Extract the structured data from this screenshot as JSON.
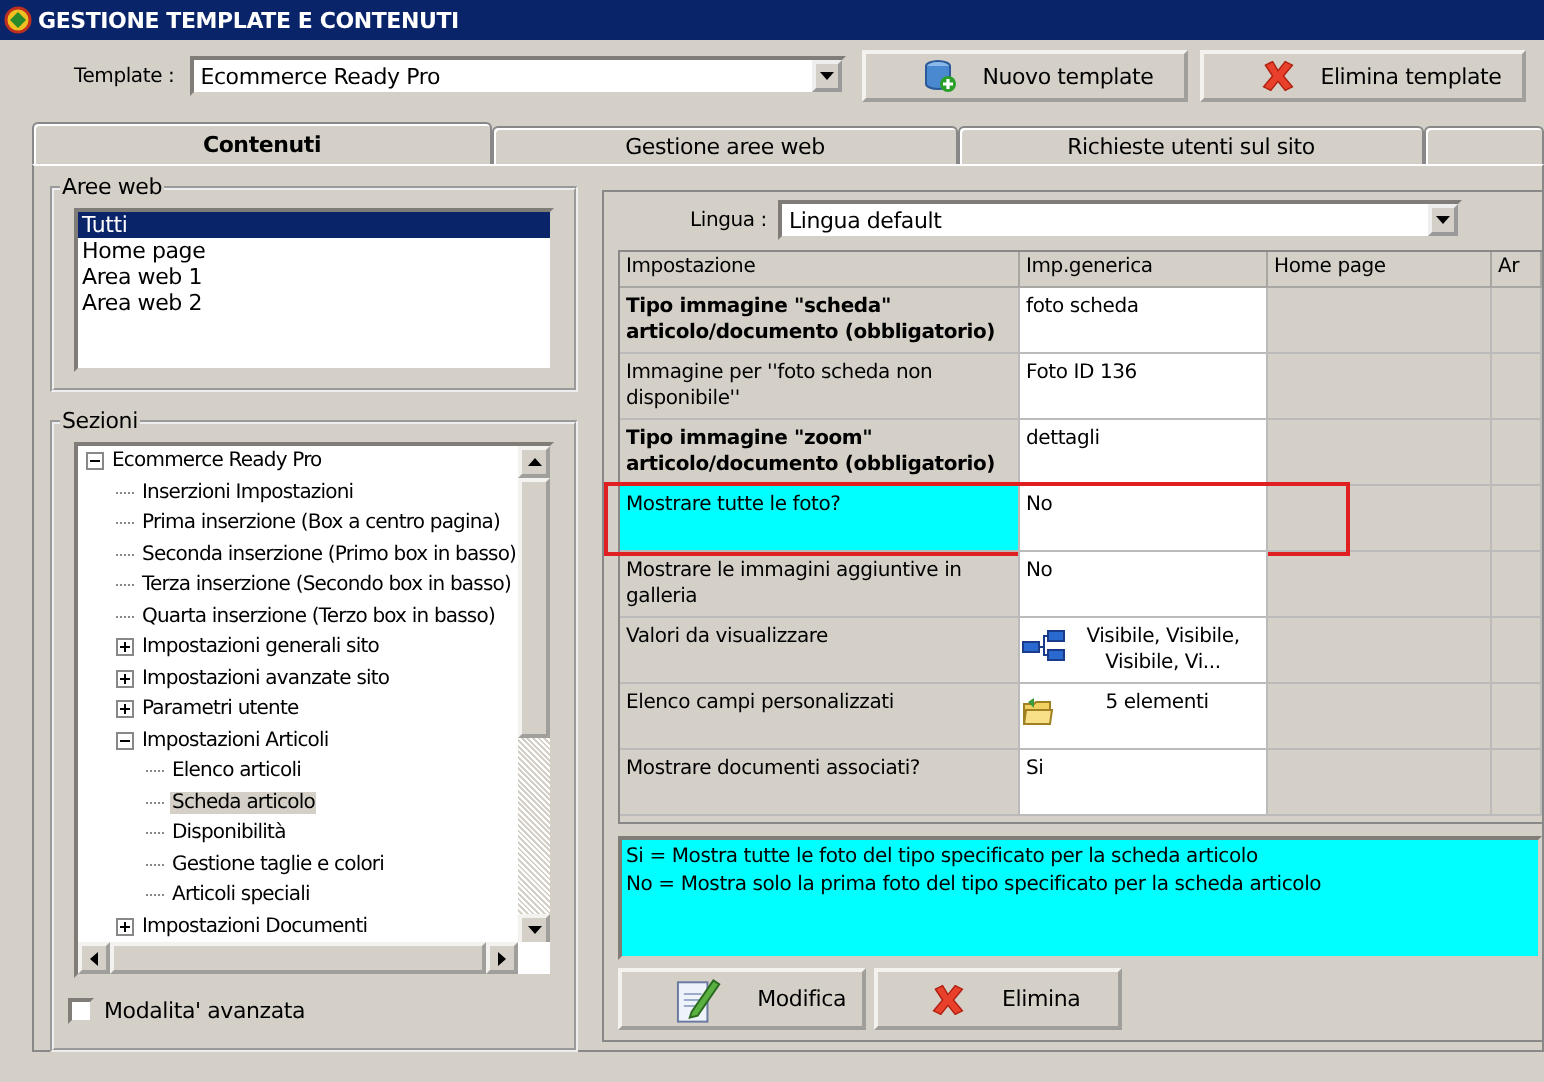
{
  "window": {
    "title": "GESTIONE TEMPLATE E CONTENUTI"
  },
  "template": {
    "label": "Template :",
    "value": "Ecommerce Ready Pro"
  },
  "toolbar_buttons": [
    {
      "label": "Nuovo template",
      "kind": "new"
    },
    {
      "label": "Elimina template",
      "kind": "delete"
    }
  ],
  "tabs": [
    {
      "label": "Contenuti",
      "selected": true
    },
    {
      "label": "Gestione aree web",
      "selected": false
    },
    {
      "label": "Richieste utenti sul sito",
      "selected": false
    }
  ],
  "aree_web": {
    "title": "Aree web",
    "items": [
      {
        "label": "Tutti",
        "selected": true
      },
      {
        "label": "Home page",
        "selected": false
      },
      {
        "label": "Area web 1",
        "selected": false
      },
      {
        "label": "Area web 2",
        "selected": false
      }
    ]
  },
  "sezioni": {
    "title": "Sezioni",
    "tree": [
      {
        "label": "Ecommerce Ready Pro",
        "kind": "folder",
        "expanded": true,
        "selected": false,
        "children": [
          {
            "label": "Inserzioni Impostazioni",
            "kind": "leaf",
            "selected": false
          },
          {
            "label": "Prima inserzione (Box a centro pagina)",
            "kind": "leaf",
            "selected": false
          },
          {
            "label": "Seconda inserzione (Primo box in basso)",
            "kind": "leaf",
            "selected": false
          },
          {
            "label": "Terza inserzione (Secondo box in basso)",
            "kind": "leaf",
            "selected": false
          },
          {
            "label": "Quarta inserzione (Terzo box in basso)",
            "kind": "leaf",
            "selected": false
          },
          {
            "label": "Impostazioni generali sito",
            "kind": "folder",
            "expanded": false,
            "selected": false
          },
          {
            "label": "Impostazioni avanzate sito",
            "kind": "folder",
            "expanded": false,
            "selected": false
          },
          {
            "label": "Parametri utente",
            "kind": "folder",
            "expanded": false,
            "selected": false
          },
          {
            "label": "Impostazioni Articoli",
            "kind": "folder",
            "expanded": true,
            "selected": false,
            "children": [
              {
                "label": "Elenco articoli",
                "kind": "leaf",
                "selected": false
              },
              {
                "label": "Scheda articolo",
                "kind": "leaf",
                "selected": true
              },
              {
                "label": "Disponibilità",
                "kind": "leaf",
                "selected": false
              },
              {
                "label": "Gestione taglie e colori",
                "kind": "leaf",
                "selected": false
              },
              {
                "label": "Articoli speciali",
                "kind": "leaf",
                "selected": false
              }
            ]
          },
          {
            "label": "Impostazioni Documenti",
            "kind": "folder",
            "expanded": false,
            "selected": false
          }
        ]
      }
    ],
    "advanced_mode": {
      "label": "Modalita' avanzata",
      "checked": false
    }
  },
  "lingua": {
    "label": "Lingua :",
    "value": "Lingua default"
  },
  "grid": {
    "columns": [
      "Impostazione",
      "Imp.generica",
      "Home page",
      "Ar"
    ],
    "rows": [
      {
        "setting": "Tipo immagine \"scheda\" articolo/documento (obbligatorio)",
        "value": "foto scheda",
        "kind": "text",
        "emphasized": true,
        "selected": false,
        "highlighted": false
      },
      {
        "setting": "Immagine per ''foto scheda non disponibile''",
        "value": "Foto ID 136",
        "kind": "text",
        "emphasized": false,
        "selected": false,
        "highlighted": false
      },
      {
        "setting": "Tipo immagine \"zoom\" articolo/documento (obbligatorio)",
        "value": "dettagli",
        "kind": "text",
        "emphasized": true,
        "selected": false,
        "highlighted": false
      },
      {
        "setting": "Mostrare tutte le foto?",
        "value": "No",
        "kind": "text",
        "emphasized": false,
        "selected": true,
        "highlighted": true
      },
      {
        "setting": "Mostrare le immagini aggiuntive in galleria",
        "value": "No",
        "kind": "text",
        "emphasized": false,
        "selected": false,
        "highlighted": false
      },
      {
        "setting": "Valori da visualizzare",
        "value": "Visibile, Visibile, Visibile, Vi...",
        "kind": "hierarchy",
        "emphasized": false,
        "selected": false,
        "highlighted": false
      },
      {
        "setting": "Elenco campi personalizzati",
        "value": "5 elementi",
        "kind": "folder",
        "emphasized": false,
        "selected": false,
        "highlighted": false
      },
      {
        "setting": "Mostrare documenti associati?",
        "value": "Si",
        "kind": "text",
        "emphasized": false,
        "selected": false,
        "highlighted": false
      }
    ]
  },
  "description": [
    "Si = Mostra tutte le foto del tipo specificato per la scheda articolo",
    "No = Mostra solo la prima foto del tipo specificato per la scheda articolo"
  ],
  "actions": [
    {
      "label": "Modifica",
      "kind": "edit"
    },
    {
      "label": "Elimina",
      "kind": "delete"
    }
  ]
}
